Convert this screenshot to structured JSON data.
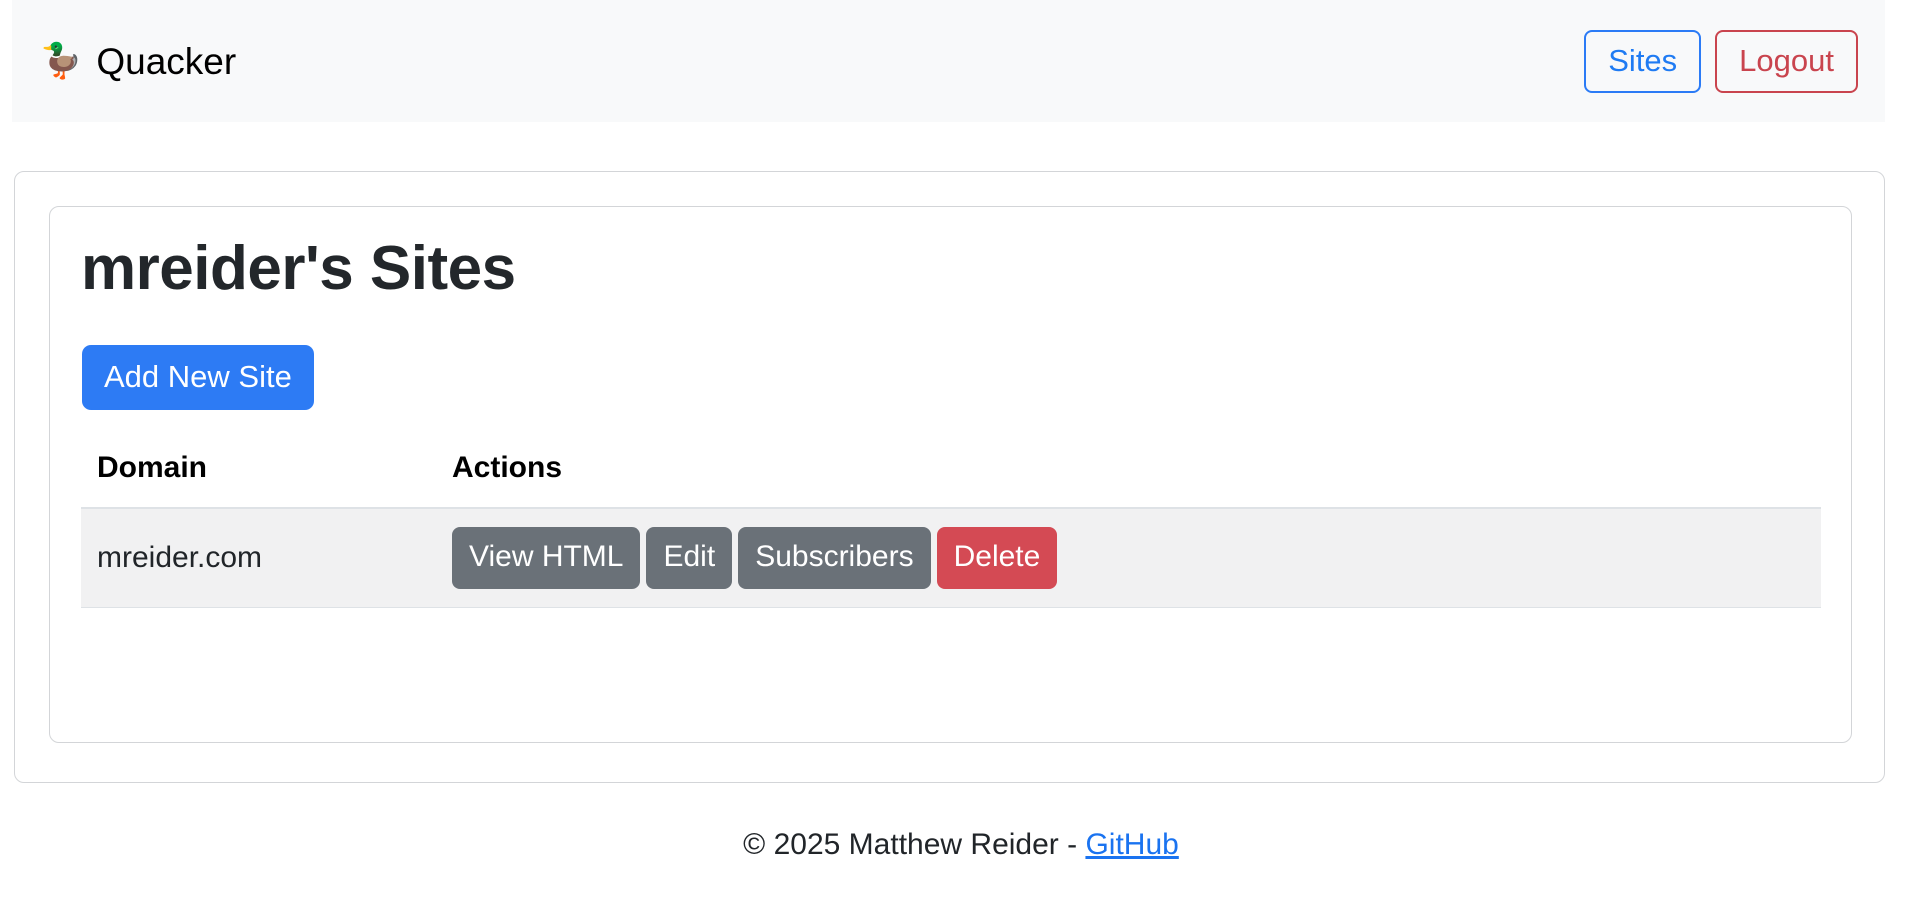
{
  "navbar": {
    "brand_emoji": "🦆",
    "brand_emoji_name": "duck-icon",
    "brand_label": "Quacker",
    "sites_label": "Sites",
    "logout_label": "Logout",
    "background_color": "#f8f9fa",
    "sites_color": "#1f7bf3",
    "logout_color": "#c9444e"
  },
  "main": {
    "page_title": "mreider's Sites",
    "add_site_label": "Add New Site",
    "add_site_color": "#2d7bf4",
    "table": {
      "columns": [
        "Domain",
        "Actions"
      ],
      "rows": [
        {
          "domain": "mreider.com",
          "actions": [
            {
              "label": "View HTML",
              "style": "secondary"
            },
            {
              "label": "Edit",
              "style": "secondary"
            },
            {
              "label": "Subscribers",
              "style": "secondary"
            },
            {
              "label": "Delete",
              "style": "danger"
            }
          ]
        }
      ],
      "secondary_color": "#6a7178",
      "danger_color": "#d44a54",
      "row_stripe_color": "#f1f1f2"
    }
  },
  "footer": {
    "copyright": "© 2025 Matthew Reider - ",
    "link_label": "GitHub",
    "link_color": "#1a73f0"
  }
}
